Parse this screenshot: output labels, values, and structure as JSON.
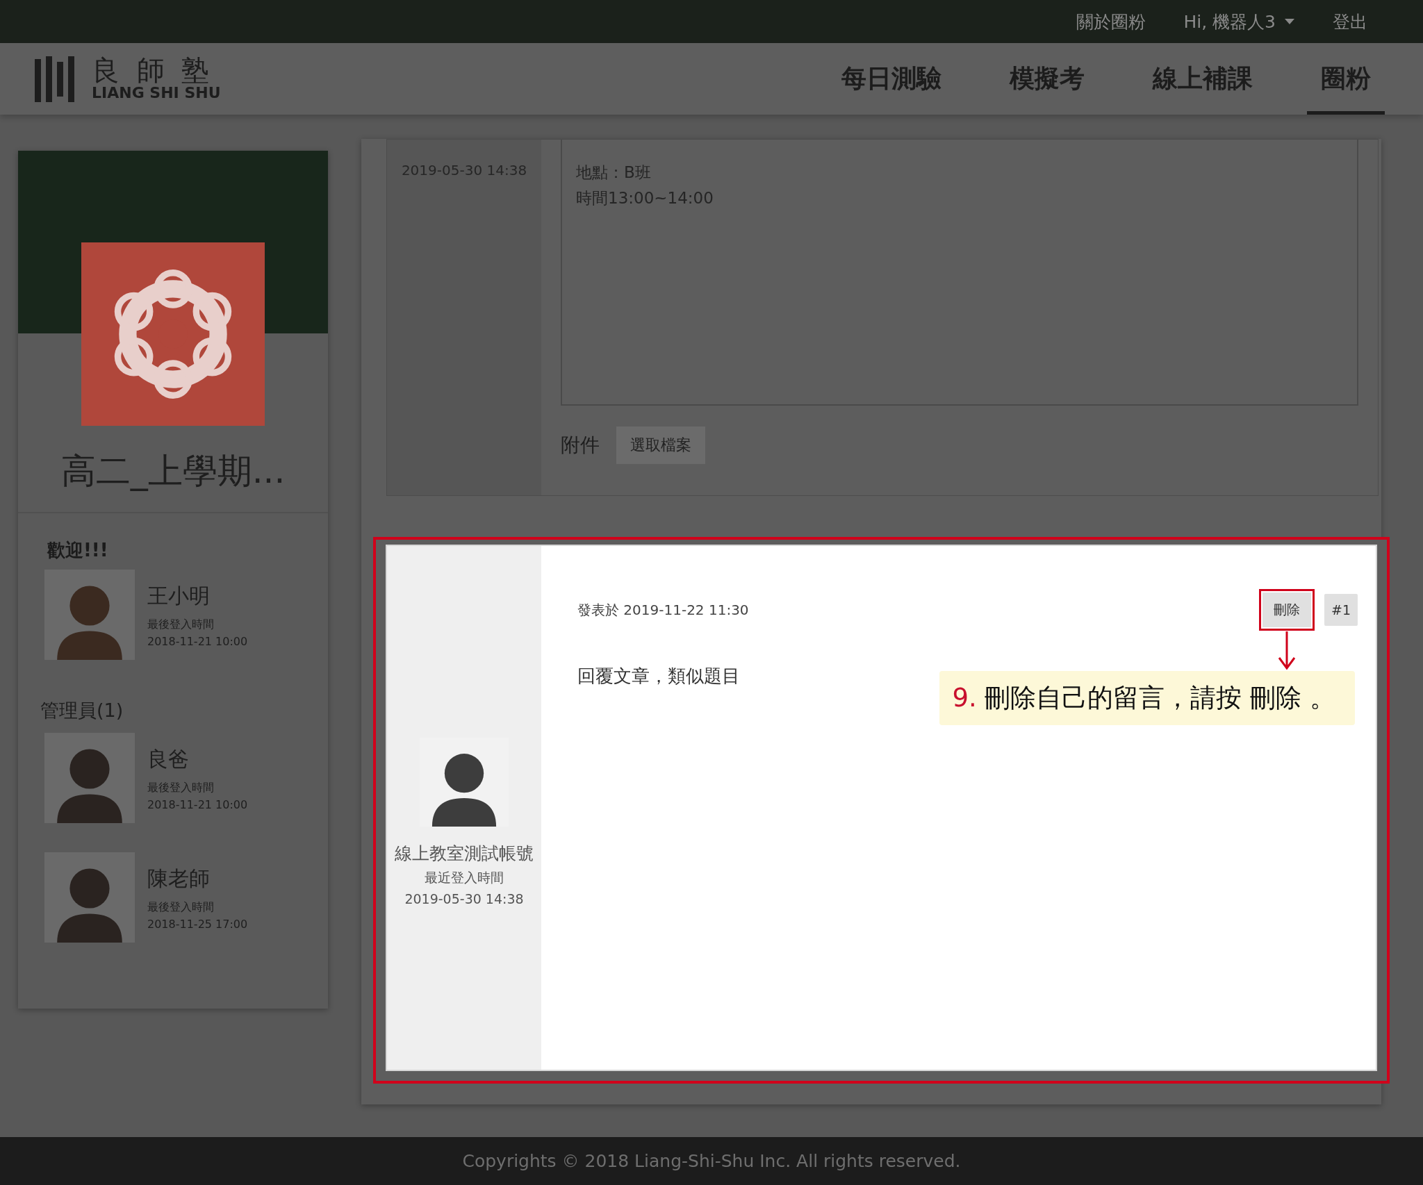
{
  "top_bar": {
    "links": [
      {
        "label": "關於圈粉",
        "kind": "link"
      },
      {
        "label": "Hi, 機器人3",
        "kind": "menu"
      },
      {
        "label": "登出",
        "kind": "link"
      }
    ]
  },
  "header": {
    "logo": {
      "title": "良 師 塾",
      "subtitle": "LIANG SHI SHU"
    },
    "nav": [
      {
        "label": "每日測驗",
        "selected": false
      },
      {
        "label": "模擬考",
        "selected": false
      },
      {
        "label": "線上補課",
        "selected": false
      },
      {
        "label": "圈粉",
        "selected": true
      }
    ]
  },
  "sidebar": {
    "group_title": "高二_上學期...",
    "welcome": "歡迎!!!",
    "current_user": {
      "name": "王小明",
      "last_login_label": "最後登入時間",
      "last_login": "2018-11-21 10:00"
    },
    "admins_heading": "管理員(1)",
    "members": [
      {
        "name": "良爸",
        "last_login_label": "最後登入時間",
        "last_login": "2018-11-21 10:00"
      },
      {
        "name": "陳老師",
        "last_login_label": "最後登入時間",
        "last_login": "2018-11-25 17:00"
      }
    ]
  },
  "previous_post": {
    "author_last_login": "2019-05-30 14:38",
    "body_lines": [
      "地點：B班",
      "時間13:00~14:00"
    ],
    "attachment_label": "附件",
    "choose_file_button": "選取檔案"
  },
  "reply_post": {
    "author": "線上教室測試帳號",
    "last_login_label": "最近登入時間",
    "last_login": "2019-05-30 14:38",
    "posted": "發表於 2019-11-22 11:30",
    "delete_button": "刪除",
    "post_number": "#1",
    "body": "回覆文章，類似題目"
  },
  "callout": {
    "step": "9.",
    "text": "刪除自己的留言，請按 刪除 。"
  },
  "footer": "Copyrights © 2018 Liang-Shi-Shu Inc. All rights reserved."
}
